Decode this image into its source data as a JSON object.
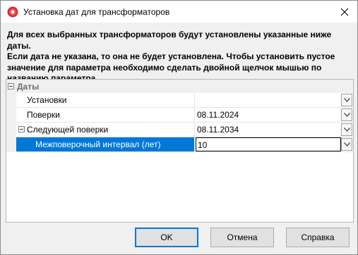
{
  "window": {
    "title": "Установка дат для трансформаторов",
    "accent_color": "#0078d7"
  },
  "notice": "Для всех выбранных трансформаторов будут установлены указанные ниже даты.\nЕсли дата не указана, то она не будет установлена. Чтобы установить пустое\nзначение для параметра необходимо сделать двойной щелчок мышью по\nназванию параметра.",
  "grid": {
    "category": "Даты",
    "rows": [
      {
        "name": "Установки",
        "value": ""
      },
      {
        "name": "Поверки",
        "value": "08.11.2024"
      },
      {
        "name": "Следующей поверки",
        "value": "08.11.2034"
      },
      {
        "name": "Межповерочный интервал (лет)",
        "value": "10"
      }
    ]
  },
  "buttons": {
    "ok": "OK",
    "cancel": "Отмена",
    "help": "Справка"
  },
  "icons": {
    "app": "red-gear-icon",
    "close": "close-icon",
    "dropdown": "chevron-down-icon",
    "collapse": "minus-box-icon"
  }
}
